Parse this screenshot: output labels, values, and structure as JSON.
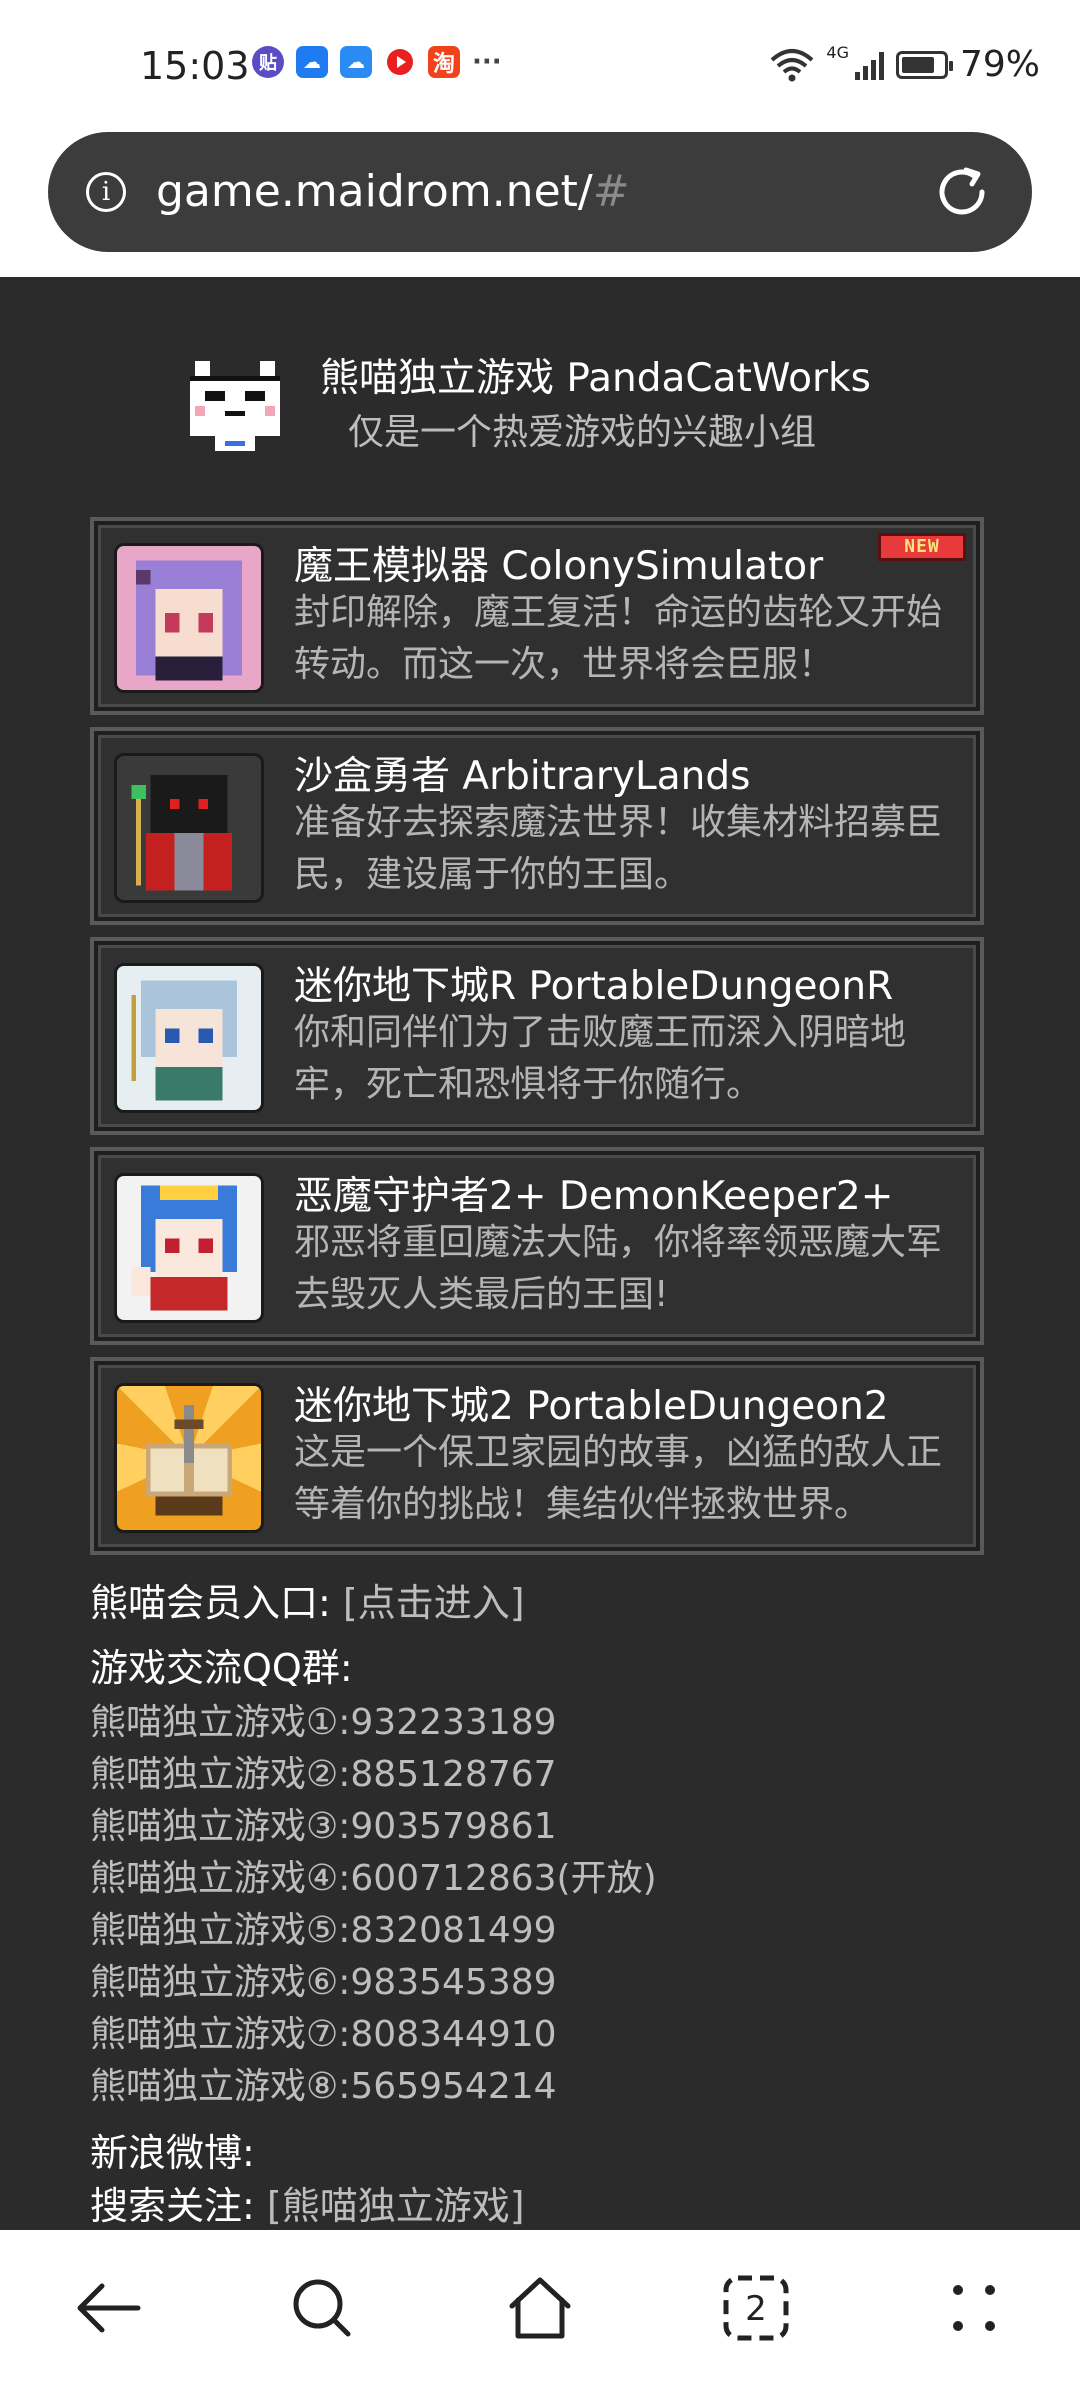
{
  "status_bar": {
    "time": "15:03",
    "notification_icons": [
      "sticker-app-icon",
      "weather-icon",
      "cloud-icon",
      "video-app-icon",
      "taobao-icon"
    ],
    "notification_glyphs": {
      "sticker": "贴",
      "taobao": "淘",
      "more": "···"
    },
    "network": "4G",
    "battery": "79%"
  },
  "address_bar": {
    "url_host": "game.maidrom.net/",
    "url_hash": "#"
  },
  "site": {
    "title": "熊喵独立游戏 PandaCatWorks",
    "subtitle": "仅是一个热爱游戏的兴趣小组"
  },
  "games": [
    {
      "title": "魔王模拟器 ColonySimulator",
      "desc": "封印解除，魔王复活！命运的齿轮又开始转动。而这一次，世界将会臣服！",
      "badge": "NEW"
    },
    {
      "title": "沙盒勇者 ArbitraryLands",
      "desc": "准备好去探索魔法世界！收集材料招募臣民，建设属于你的王国。"
    },
    {
      "title": "迷你地下城R PortableDungeonR",
      "desc": "你和同伴们为了击败魔王而深入阴暗地牢，死亡和恐惧将于你随行。"
    },
    {
      "title": "恶魔守护者2+ DemonKeeper2+",
      "desc": "邪恶将重回魔法大陆，你将率领恶魔大军去毁灭人类最后的王国!"
    },
    {
      "title": "迷你地下城2 PortableDungeon2",
      "desc": "这是一个保卫家园的故事，凶猛的敌人正等着你的挑战！集结伙伴拯救世界。"
    }
  ],
  "member": {
    "label": "熊喵会员入口:",
    "link": "[点击进入]"
  },
  "qq": {
    "heading": "游戏交流QQ群:",
    "groups": [
      "熊喵独立游戏①:932233189",
      "熊喵独立游戏②:885128767",
      "熊喵独立游戏③:903579861",
      "熊喵独立游戏④:600712863(开放)",
      "熊喵独立游戏⑤:832081499",
      "熊喵独立游戏⑥:983545389",
      "熊喵独立游戏⑦:808344910",
      "熊喵独立游戏⑧:565954214"
    ]
  },
  "weibo": {
    "heading": "新浪微博:",
    "search_label": "搜索关注:",
    "search_link": "[熊喵独立游戏]"
  },
  "bottom_nav": {
    "tab_count": "2",
    "icons": [
      "back-icon",
      "search-icon",
      "home-icon",
      "tabs-icon",
      "menu-icon"
    ]
  }
}
